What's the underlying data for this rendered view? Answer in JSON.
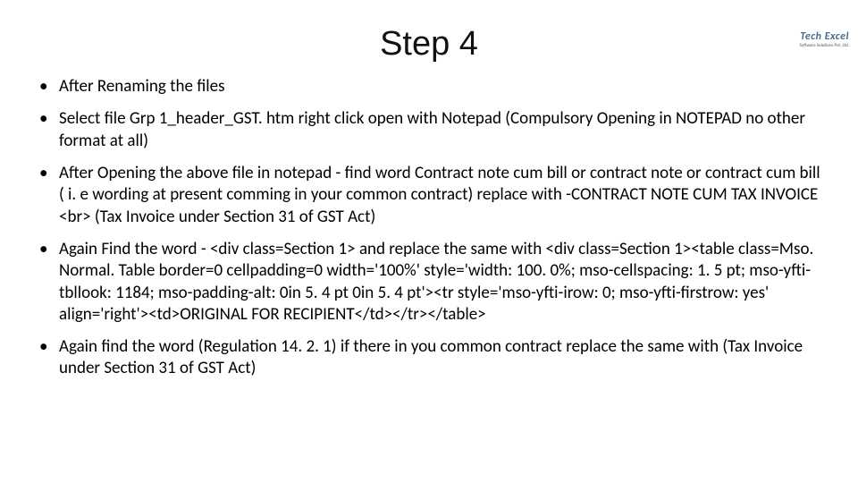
{
  "logo": {
    "brand": "Tech Excel",
    "tagline": "Software Solutions Pvt. Ltd."
  },
  "title": "Step 4",
  "bullets": [
    "After Renaming the files",
    "Select file Grp 1_header_GST. htm right click open with Notepad (Compulsory Opening in NOTEPAD no other format at all)",
    "After Opening the above file in notepad - find word Contract note cum bill or contract note or contract cum bill  ( i. e wording at present comming in your common contract) replace with -CONTRACT NOTE CUM TAX INVOICE <br> (Tax Invoice under Section 31 of GST Act)",
    "Again Find the word - <div class=Section 1> and replace the same with <div class=Section 1><table class=Mso. Normal. Table border=0 cellpadding=0 width='100%' style='width: 100. 0%; mso-cellspacing: 1. 5 pt; mso-yfti-tbllook: 1184; mso-padding-alt: 0in 5. 4 pt 0in 5. 4 pt'><tr style='mso-yfti-irow: 0; mso-yfti-firstrow: yes' align='right'><td>ORIGINAL FOR RECIPIENT</td></tr></table>",
    "Again find the word (Regulation 14. 2. 1) if there in you common contract replace the same with (Tax Invoice under Section 31 of GST Act)"
  ]
}
